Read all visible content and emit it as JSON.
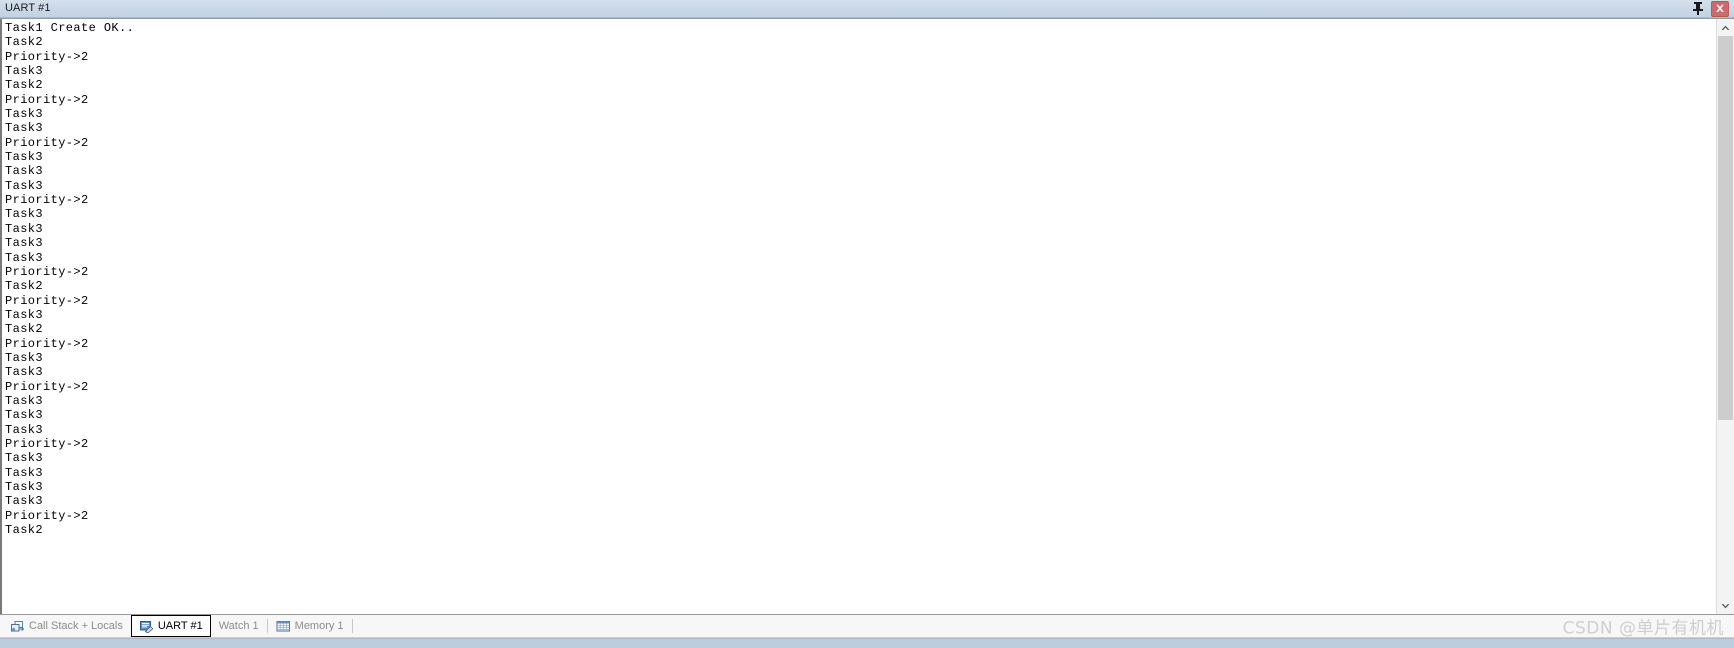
{
  "window": {
    "title": "UART #1",
    "pin_icon": "pin-icon",
    "close_icon": "close-icon",
    "close_color": "#cc6b6b"
  },
  "terminal": {
    "lines": [
      "Task1 Create OK..",
      "Task2",
      "Priority->2",
      "Task3",
      "Task2",
      "Priority->2",
      "Task3",
      "Task3",
      "Priority->2",
      "Task3",
      "Task3",
      "Task3",
      "Priority->2",
      "Task3",
      "Task3",
      "Task3",
      "Task3",
      "Priority->2",
      "Task2",
      "Priority->2",
      "Task3",
      "Task2",
      "Priority->2",
      "Task3",
      "Task3",
      "Priority->2",
      "Task3",
      "Task3",
      "Task3",
      "Priority->2",
      "Task3",
      "Task3",
      "Task3",
      "Task3",
      "Priority->2",
      "Task2"
    ]
  },
  "scrollbar": {
    "up_icon": "chevron-up-icon",
    "down_icon": "chevron-down-icon",
    "thumb_top_percent": 0,
    "thumb_height_percent": 68.5
  },
  "tabs": [
    {
      "label": "Call Stack + Locals",
      "icon": "call-stack-icon",
      "active": false
    },
    {
      "label": "UART #1",
      "icon": "uart-icon",
      "active": true
    },
    {
      "label": "Watch 1",
      "icon": "",
      "active": false
    },
    {
      "label": "Memory 1",
      "icon": "memory-icon",
      "active": false
    }
  ],
  "watermark": {
    "text": "CSDN @单片有机机"
  }
}
